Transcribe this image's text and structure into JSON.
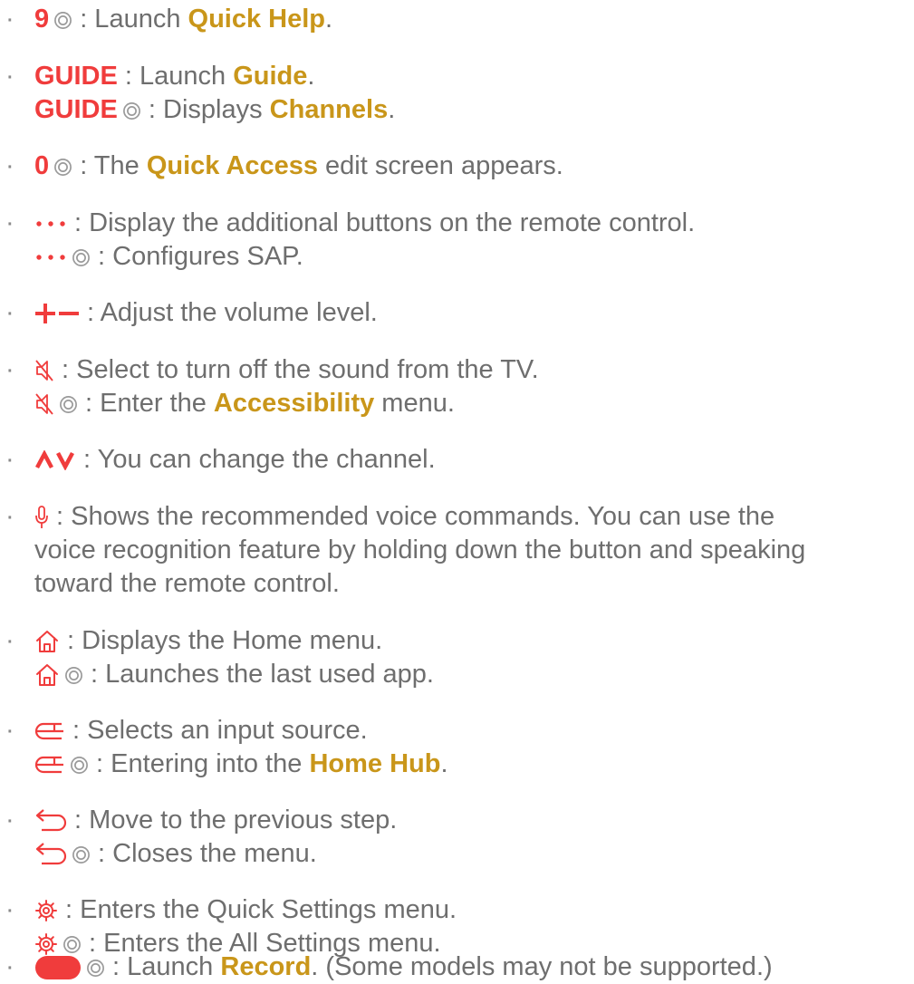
{
  "bullet": "·",
  "colors": {
    "key_red": "#f03c3c",
    "emphasis_gold": "#c9961a",
    "body_text": "#6e6e6e",
    "hold_icon": "#9a9a9a"
  },
  "items": [
    {
      "id": "quick-help",
      "lines": [
        [
          {
            "t": "key",
            "text": "9"
          },
          {
            "t": "hold",
            "icon": "hold-icon"
          },
          {
            "t": "text",
            "text": " : Launch "
          },
          {
            "t": "em",
            "text": "Quick Help"
          },
          {
            "t": "text",
            "text": "."
          }
        ]
      ]
    },
    {
      "id": "guide",
      "lines": [
        [
          {
            "t": "key",
            "text": "GUIDE"
          },
          {
            "t": "text",
            "text": " : Launch "
          },
          {
            "t": "em",
            "text": "Guide"
          },
          {
            "t": "text",
            "text": "."
          }
        ],
        [
          {
            "t": "key",
            "text": "GUIDE"
          },
          {
            "t": "hold",
            "icon": "hold-icon"
          },
          {
            "t": "text",
            "text": " : Displays "
          },
          {
            "t": "em",
            "text": "Channels"
          },
          {
            "t": "text",
            "text": "."
          }
        ]
      ]
    },
    {
      "id": "quick-access",
      "lines": [
        [
          {
            "t": "key",
            "text": "0"
          },
          {
            "t": "hold",
            "icon": "hold-icon"
          },
          {
            "t": "text",
            "text": " : The "
          },
          {
            "t": "em",
            "text": "Quick Access"
          },
          {
            "t": "text",
            "text": " edit screen appears."
          }
        ]
      ]
    },
    {
      "id": "more-buttons",
      "lines": [
        [
          {
            "t": "icon",
            "icon": "more-dots-icon"
          },
          {
            "t": "text",
            "text": " : Display the additional buttons on the remote control."
          }
        ],
        [
          {
            "t": "icon",
            "icon": "more-dots-icon"
          },
          {
            "t": "hold",
            "icon": "hold-icon"
          },
          {
            "t": "text",
            "text": " : Configures SAP."
          }
        ]
      ]
    },
    {
      "id": "volume",
      "lines": [
        [
          {
            "t": "icon",
            "icon": "volume-plus-minus-icon"
          },
          {
            "t": "text",
            "text": " : Adjust the volume level."
          }
        ]
      ]
    },
    {
      "id": "mute",
      "lines": [
        [
          {
            "t": "icon",
            "icon": "mute-icon"
          },
          {
            "t": "text",
            "text": " : Select to turn off the sound from the TV."
          }
        ],
        [
          {
            "t": "icon",
            "icon": "mute-icon"
          },
          {
            "t": "hold",
            "icon": "hold-icon"
          },
          {
            "t": "text",
            "text": " : Enter the "
          },
          {
            "t": "em",
            "text": "Accessibility"
          },
          {
            "t": "text",
            "text": " menu."
          }
        ]
      ]
    },
    {
      "id": "channel",
      "lines": [
        [
          {
            "t": "icon",
            "icon": "channel-up-down-icon"
          },
          {
            "t": "text",
            "text": " : You can change the channel."
          }
        ]
      ]
    },
    {
      "id": "voice",
      "lines": [
        [
          {
            "t": "icon",
            "icon": "microphone-icon"
          },
          {
            "t": "text",
            "text": " : Shows the recommended voice commands. You can use the"
          }
        ],
        [
          {
            "t": "text",
            "text": "voice recognition feature by holding down the button and speaking"
          }
        ],
        [
          {
            "t": "text",
            "text": "toward the remote control."
          }
        ]
      ]
    },
    {
      "id": "home",
      "lines": [
        [
          {
            "t": "icon",
            "icon": "home-icon"
          },
          {
            "t": "text",
            "text": " : Displays the Home menu."
          }
        ],
        [
          {
            "t": "icon",
            "icon": "home-icon"
          },
          {
            "t": "hold",
            "icon": "hold-icon"
          },
          {
            "t": "text",
            "text": " : Launches the last used app."
          }
        ]
      ]
    },
    {
      "id": "input",
      "lines": [
        [
          {
            "t": "icon",
            "icon": "input-source-icon"
          },
          {
            "t": "text",
            "text": " : Selects an input source."
          }
        ],
        [
          {
            "t": "icon",
            "icon": "input-source-icon"
          },
          {
            "t": "hold",
            "icon": "hold-icon"
          },
          {
            "t": "text",
            "text": " : Entering into the "
          },
          {
            "t": "em",
            "text": "Home Hub"
          },
          {
            "t": "text",
            "text": "."
          }
        ]
      ]
    },
    {
      "id": "back",
      "lines": [
        [
          {
            "t": "icon",
            "icon": "back-icon"
          },
          {
            "t": "text",
            "text": " : Move to the previous step."
          }
        ],
        [
          {
            "t": "icon",
            "icon": "back-icon"
          },
          {
            "t": "hold",
            "icon": "hold-icon"
          },
          {
            "t": "text",
            "text": " : Closes the menu."
          }
        ]
      ]
    },
    {
      "id": "settings",
      "lines": [
        [
          {
            "t": "icon",
            "icon": "settings-gear-icon"
          },
          {
            "t": "text",
            "text": " : Enters the Quick Settings menu."
          }
        ],
        [
          {
            "t": "icon",
            "icon": "settings-gear-icon"
          },
          {
            "t": "hold",
            "icon": "hold-icon"
          },
          {
            "t": "text",
            "text": " : Enters the All Settings menu."
          }
        ]
      ]
    },
    {
      "id": "record",
      "lines": [
        [
          {
            "t": "icon",
            "icon": "record-button-icon"
          },
          {
            "t": "hold",
            "icon": "hold-icon"
          },
          {
            "t": "text",
            "text": " : Launch "
          },
          {
            "t": "em",
            "text": "Record"
          },
          {
            "t": "text",
            "text": ". (Some models may not be supported.)"
          }
        ]
      ]
    }
  ]
}
